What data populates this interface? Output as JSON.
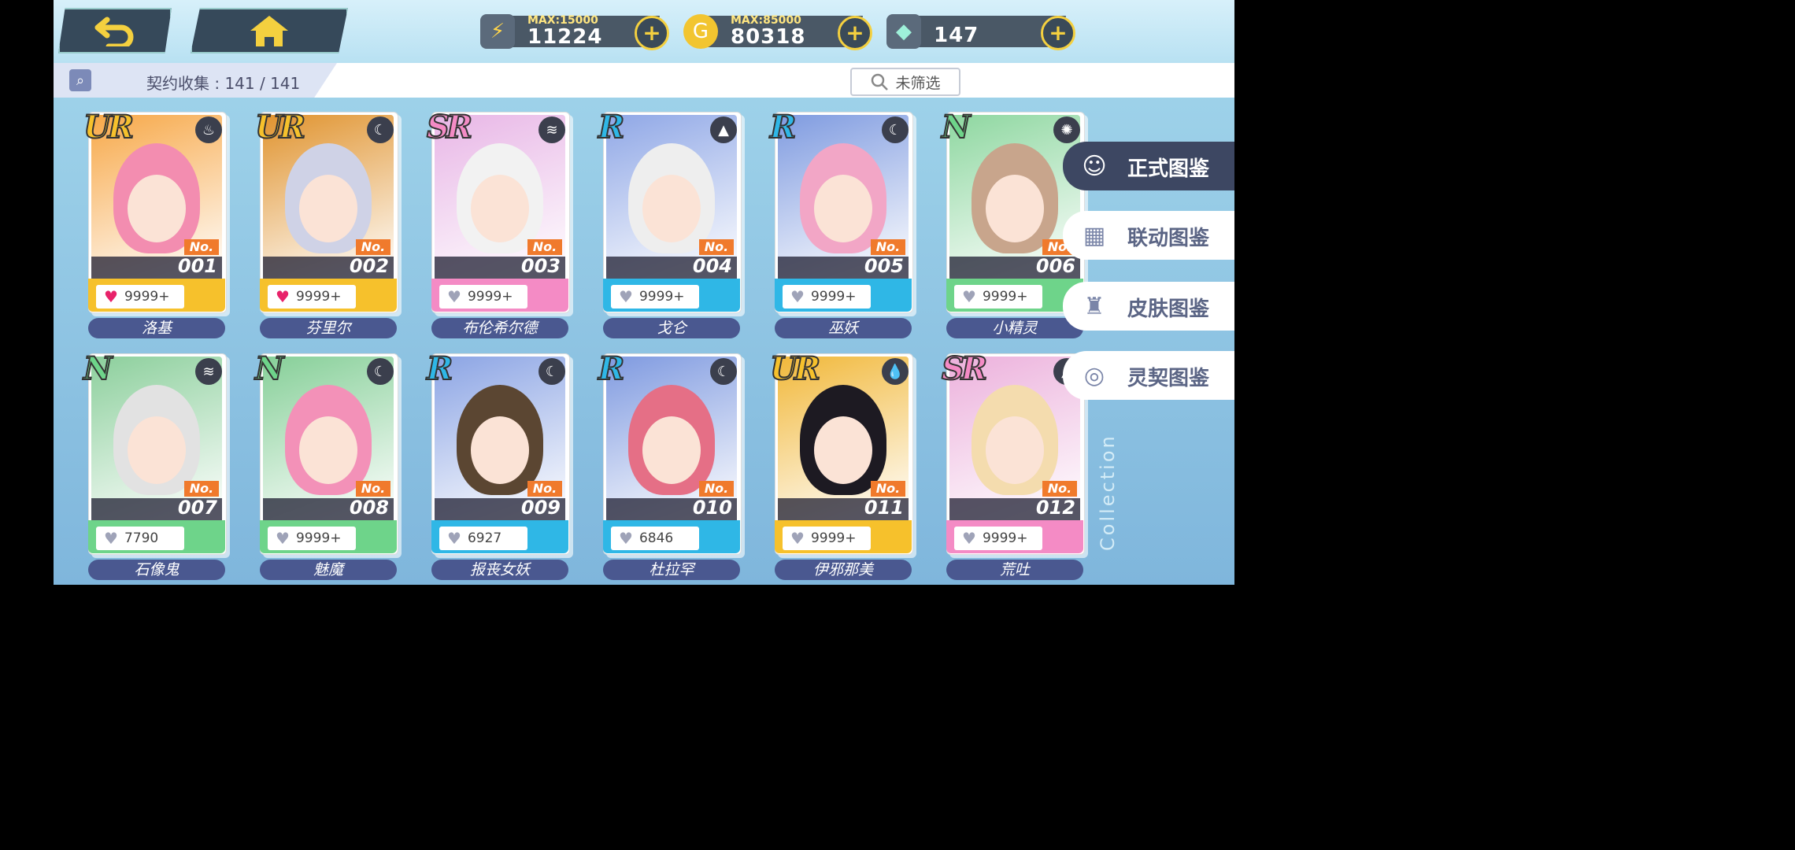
{
  "topbar": {
    "back_icon": "back-arrow-icon",
    "home_icon": "home-icon",
    "resources": [
      {
        "icon": "energy-battery-icon",
        "max": "MAX:15000",
        "value": "11224",
        "plus": "+"
      },
      {
        "icon": "gold-coin-icon",
        "max": "MAX:85000",
        "value": "80318",
        "plus": "+"
      },
      {
        "icon": "crystal-gem-icon",
        "max": "",
        "value": "147",
        "plus": "+"
      }
    ]
  },
  "header": {
    "title": "契约收集 : 141 / 141",
    "filter_label": "未筛选"
  },
  "colors": {
    "UR": "#f6c12c",
    "SR": "#f48bc5",
    "R": "#2fb7e6",
    "N": "#6ed48a",
    "accent": "#f07a2c"
  },
  "cards": [
    {
      "rarity": "UR",
      "no_label": "No.",
      "no": "001",
      "hearts": "9999+",
      "liked": true,
      "name": "洛基",
      "elem": "flame-icon",
      "hair": "#f38db0",
      "bg": "#f7a848"
    },
    {
      "rarity": "UR",
      "no_label": "No.",
      "no": "002",
      "hearts": "9999+",
      "liked": true,
      "name": "芬里尔",
      "elem": "star-moon-icon",
      "hair": "#cfd2e6",
      "bg": "#e0932e"
    },
    {
      "rarity": "SR",
      "no_label": "No.",
      "no": "003",
      "hearts": "9999+",
      "liked": false,
      "name": "布伦希尔德",
      "elem": "wind-icon",
      "hair": "#f2f2f2",
      "bg": "#e8b6e6"
    },
    {
      "rarity": "R",
      "no_label": "No.",
      "no": "004",
      "hearts": "9999+",
      "liked": false,
      "name": "戈仑",
      "elem": "earth-icon",
      "hair": "#eeeeee",
      "bg": "#8fa7e6"
    },
    {
      "rarity": "R",
      "no_label": "No.",
      "no": "005",
      "hearts": "9999+",
      "liked": false,
      "name": "巫妖",
      "elem": "star-moon-icon",
      "hair": "#f2a6c6",
      "bg": "#7f9be0"
    },
    {
      "rarity": "N",
      "no_label": "No.",
      "no": "006",
      "hearts": "9999+",
      "liked": false,
      "name": "小精灵",
      "elem": "sun-icon",
      "hair": "#c8a58c",
      "bg": "#8ed7a0"
    },
    {
      "rarity": "N",
      "no_label": "No.",
      "no": "007",
      "hearts": "7790",
      "liked": false,
      "name": "石像鬼",
      "elem": "wind-icon",
      "hair": "#e2e2e2",
      "bg": "#8ccf9c"
    },
    {
      "rarity": "N",
      "no_label": "No.",
      "no": "008",
      "hearts": "9999+",
      "liked": false,
      "name": "魅魔",
      "elem": "star-moon-icon",
      "hair": "#f391b8",
      "bg": "#86cf98"
    },
    {
      "rarity": "R",
      "no_label": "No.",
      "no": "009",
      "hearts": "6927",
      "liked": false,
      "name": "报丧女妖",
      "elem": "star-moon-icon",
      "hair": "#5b4632",
      "bg": "#8ba4e4"
    },
    {
      "rarity": "R",
      "no_label": "No.",
      "no": "010",
      "hearts": "6846",
      "liked": false,
      "name": "杜拉罕",
      "elem": "star-moon-icon",
      "hair": "#e56f86",
      "bg": "#7f9ae0"
    },
    {
      "rarity": "UR",
      "no_label": "No.",
      "no": "011",
      "hearts": "9999+",
      "liked": false,
      "name": "伊邪那美",
      "elem": "water-drop-icon",
      "hair": "#1d1a22",
      "bg": "#f1b83a"
    },
    {
      "rarity": "SR",
      "no_label": "No.",
      "no": "012",
      "hearts": "9999+",
      "liked": false,
      "name": "荒吐",
      "elem": "earth-icon",
      "hair": "#f4dcae",
      "bg": "#ecb1dc"
    }
  ],
  "side_tabs": [
    {
      "label": "正式图鉴",
      "icon": "character-face-icon",
      "active": true
    },
    {
      "label": "联动图鉴",
      "icon": "calendar-star-icon",
      "active": false
    },
    {
      "label": "皮肤图鉴",
      "icon": "shirt-icon",
      "active": false
    },
    {
      "label": "灵契图鉴",
      "icon": "heart-ring-icon",
      "active": false
    }
  ],
  "watermark": "Collection"
}
